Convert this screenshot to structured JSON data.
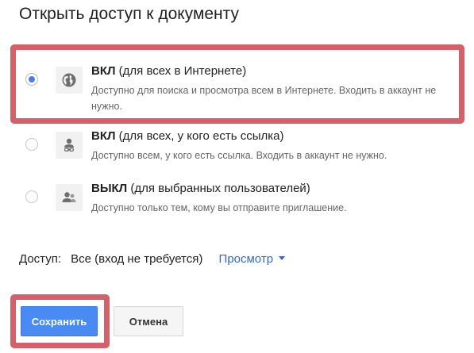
{
  "dialog": {
    "title": "Открыть доступ к документу"
  },
  "options": [
    {
      "label_bold": "ВКЛ",
      "label_rest": " (для всех в Интернете)",
      "description": "Доступно для поиска и просмотра всем в Интернете. Входить в аккаунт не нужно.",
      "selected": true,
      "icon": "globe-icon"
    },
    {
      "label_bold": "ВКЛ",
      "label_rest": " (для всех, у кого есть ссылка)",
      "description": "Доступно всем, у кого есть ссылка. Входить в аккаунт не нужно.",
      "selected": false,
      "icon": "person-link-icon"
    },
    {
      "label_bold": "ВЫКЛ",
      "label_rest": " (для выбранных пользователей)",
      "description": "Доступно только тем, кому вы отправите приглашение.",
      "selected": false,
      "icon": "people-icon"
    }
  ],
  "access": {
    "label": "Доступ:",
    "value": "Все (вход не требуется)",
    "dropdown": "Просмотр"
  },
  "buttons": {
    "save": "Сохранить",
    "cancel": "Отмена"
  },
  "colors": {
    "accent": "#4a8af4",
    "link": "#3367d6",
    "highlight": "#d5606a"
  }
}
